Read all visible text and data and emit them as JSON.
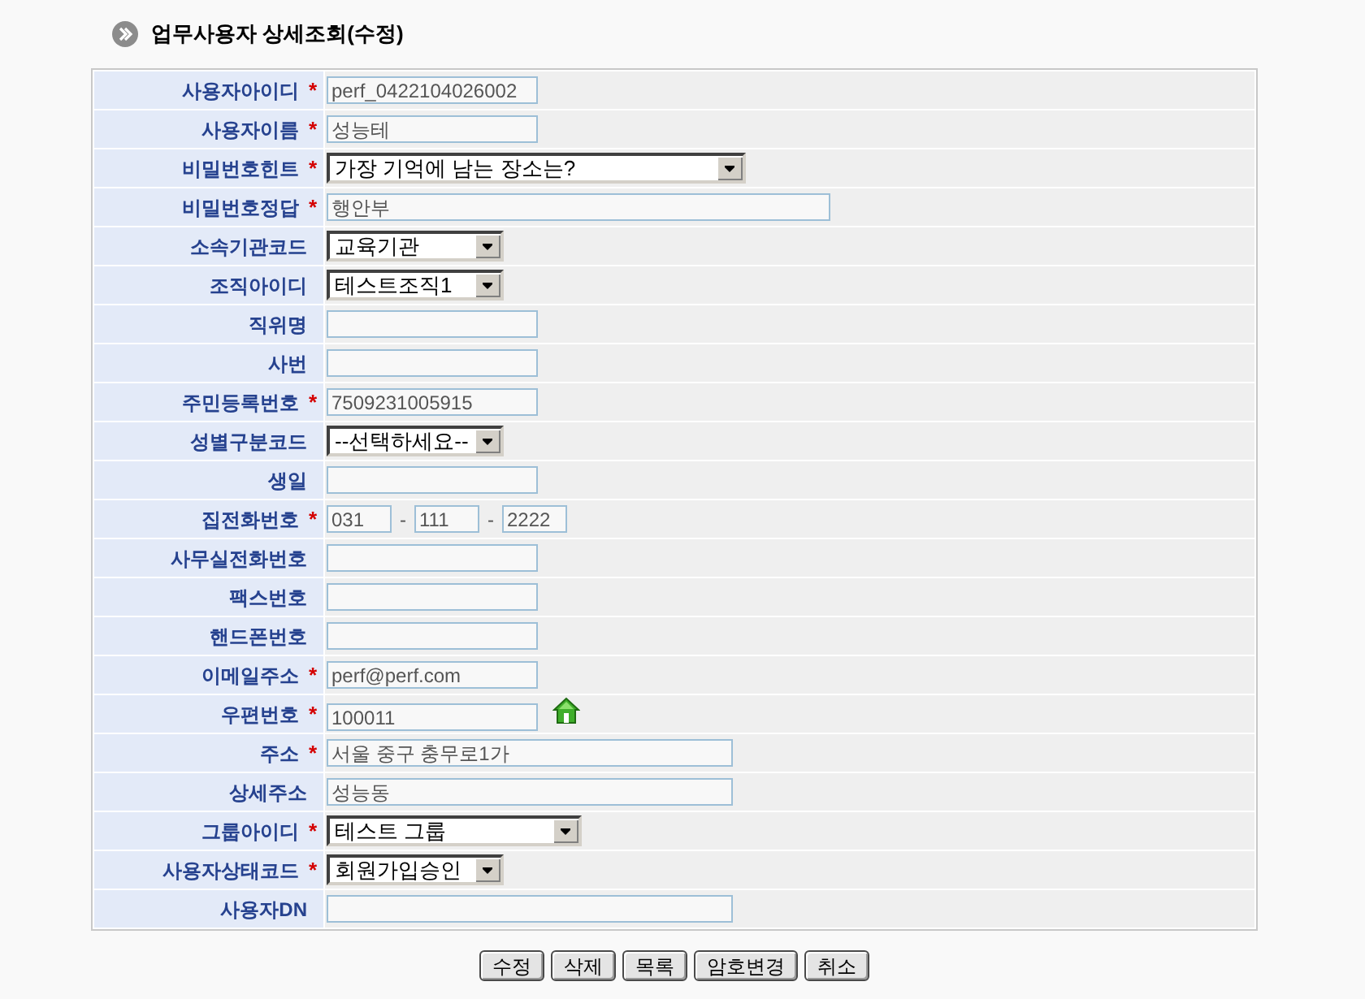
{
  "page": {
    "title": "업무사용자 상세조회(수정)"
  },
  "form": {
    "rows": [
      {
        "label": "사용자아이디",
        "marker": "*",
        "kind": "input",
        "value": "perf_0422104026002"
      },
      {
        "label": "사용자이름",
        "marker": "*",
        "kind": "input",
        "value": "성능테"
      },
      {
        "label": "비밀번호힌트",
        "marker": "*",
        "kind": "select",
        "value": "가장 기억에 남는 장소는?"
      },
      {
        "label": "비밀번호정답",
        "marker": "*",
        "kind": "input",
        "value": "행안부"
      },
      {
        "label": "소속기관코드",
        "kind": "select",
        "value": "교육기관"
      },
      {
        "label": "조직아이디",
        "kind": "select",
        "value": "테스트조직1"
      },
      {
        "label": "직위명",
        "kind": "input"
      },
      {
        "label": "사번",
        "kind": "input"
      },
      {
        "label": "주민등록번호",
        "marker": "*",
        "kind": "input",
        "value": "7509231005915"
      },
      {
        "label": "성별구분코드",
        "kind": "select",
        "value": "--선택하세요--"
      },
      {
        "label": "생일",
        "kind": "input"
      },
      {
        "label": "집전화번호",
        "marker": "*",
        "kind": "phone",
        "parts": [
          "031",
          "111",
          "2222"
        ],
        "separators": [
          "-",
          "-"
        ]
      },
      {
        "label": "사무실전화번호",
        "kind": "input"
      },
      {
        "label": "팩스번호",
        "kind": "input"
      },
      {
        "label": "핸드폰번호",
        "kind": "input"
      },
      {
        "label": "이메일주소",
        "marker": "*",
        "kind": "input",
        "value": "perf@perf.com"
      },
      {
        "label": "우편번호",
        "marker": "*",
        "kind": "postal",
        "value": "100011"
      },
      {
        "label": "주소",
        "marker": "*",
        "kind": "input",
        "value": "서울 중구 충무로1가"
      },
      {
        "label": "상세주소",
        "kind": "input",
        "value": "성능동"
      },
      {
        "label": "그룹아이디",
        "marker": "*",
        "kind": "select",
        "value": "테스트 그룹"
      },
      {
        "label": "사용자상태코드",
        "marker": "*",
        "kind": "select",
        "value": "회원가입승인"
      },
      {
        "label": "사용자DN",
        "kind": "input"
      }
    ]
  },
  "buttons": [
    "수정",
    "삭제",
    "목록",
    "암호변경",
    "취소"
  ]
}
